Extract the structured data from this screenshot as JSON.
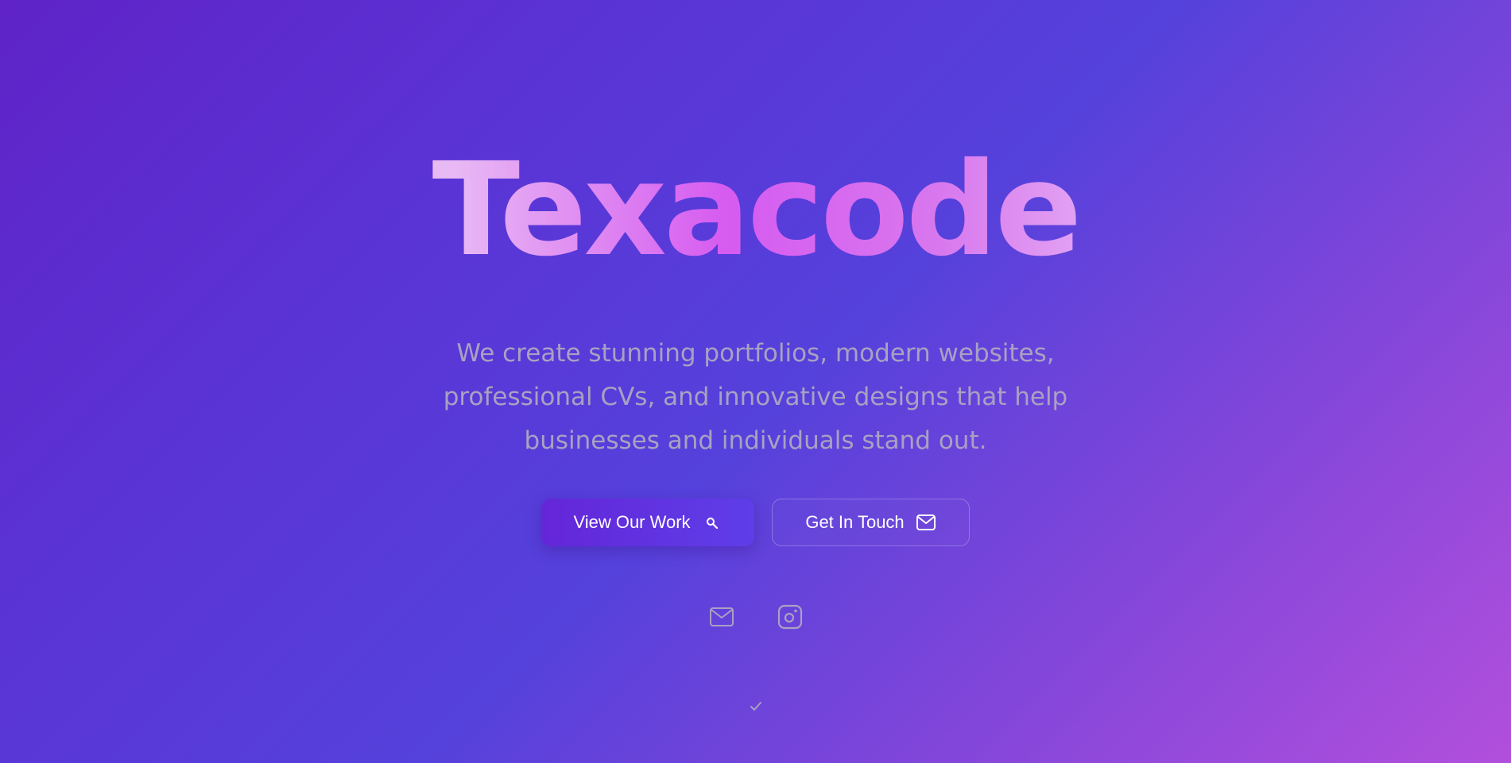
{
  "hero": {
    "title": "Texacode",
    "tagline": "We create stunning portfolios, modern websites, professional CVs, and innovative designs that help businesses and individuals stand out."
  },
  "buttons": {
    "primary_label": "View Our Work",
    "primary_icon": "magnifier-icon",
    "secondary_label": "Get In Touch",
    "secondary_icon": "mail-icon"
  },
  "social": {
    "items": [
      {
        "icon": "mail-icon"
      },
      {
        "icon": "instagram-icon"
      }
    ]
  },
  "scroll": {
    "icon": "check-icon"
  },
  "colors": {
    "background_start": "#5f23c7",
    "background_mid": "#5541db",
    "background_end": "#b24fdc",
    "title_accent": "#d65bf0",
    "tagline_text": "#a9a1c2",
    "primary_button": "#6426d8"
  }
}
